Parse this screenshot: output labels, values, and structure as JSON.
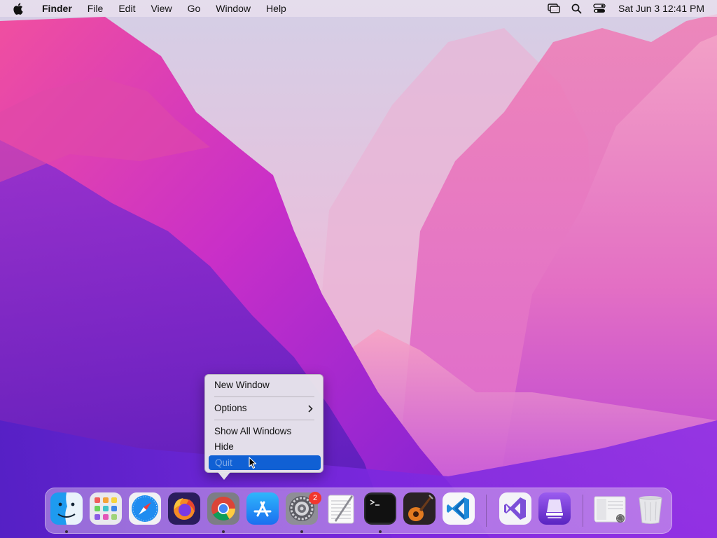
{
  "menubar": {
    "app_name": "Finder",
    "menus": [
      "File",
      "Edit",
      "View",
      "Go",
      "Window",
      "Help"
    ],
    "clock": "Sat Jun 3  12:41 PM"
  },
  "context_menu": {
    "items": [
      "New Window",
      "Options",
      "Show All Windows",
      "Hide",
      "Quit"
    ],
    "highlighted": "Quit"
  },
  "dock": {
    "apps": [
      "Finder",
      "Launchpad",
      "Safari",
      "Firefox",
      "Google Chrome",
      "App Store",
      "System Preferences",
      "TextEdit",
      "Terminal",
      "GarageBand",
      "Visual Studio Code",
      "Visual Studio",
      "Apple Configurator",
      "Downloads",
      "Trash"
    ],
    "system_preferences_badge": "2",
    "running": [
      "Finder",
      "Google Chrome",
      "System Preferences",
      "Terminal"
    ]
  },
  "colors": {
    "menu_highlight": "#1060d4",
    "badge": "#f2362e"
  }
}
